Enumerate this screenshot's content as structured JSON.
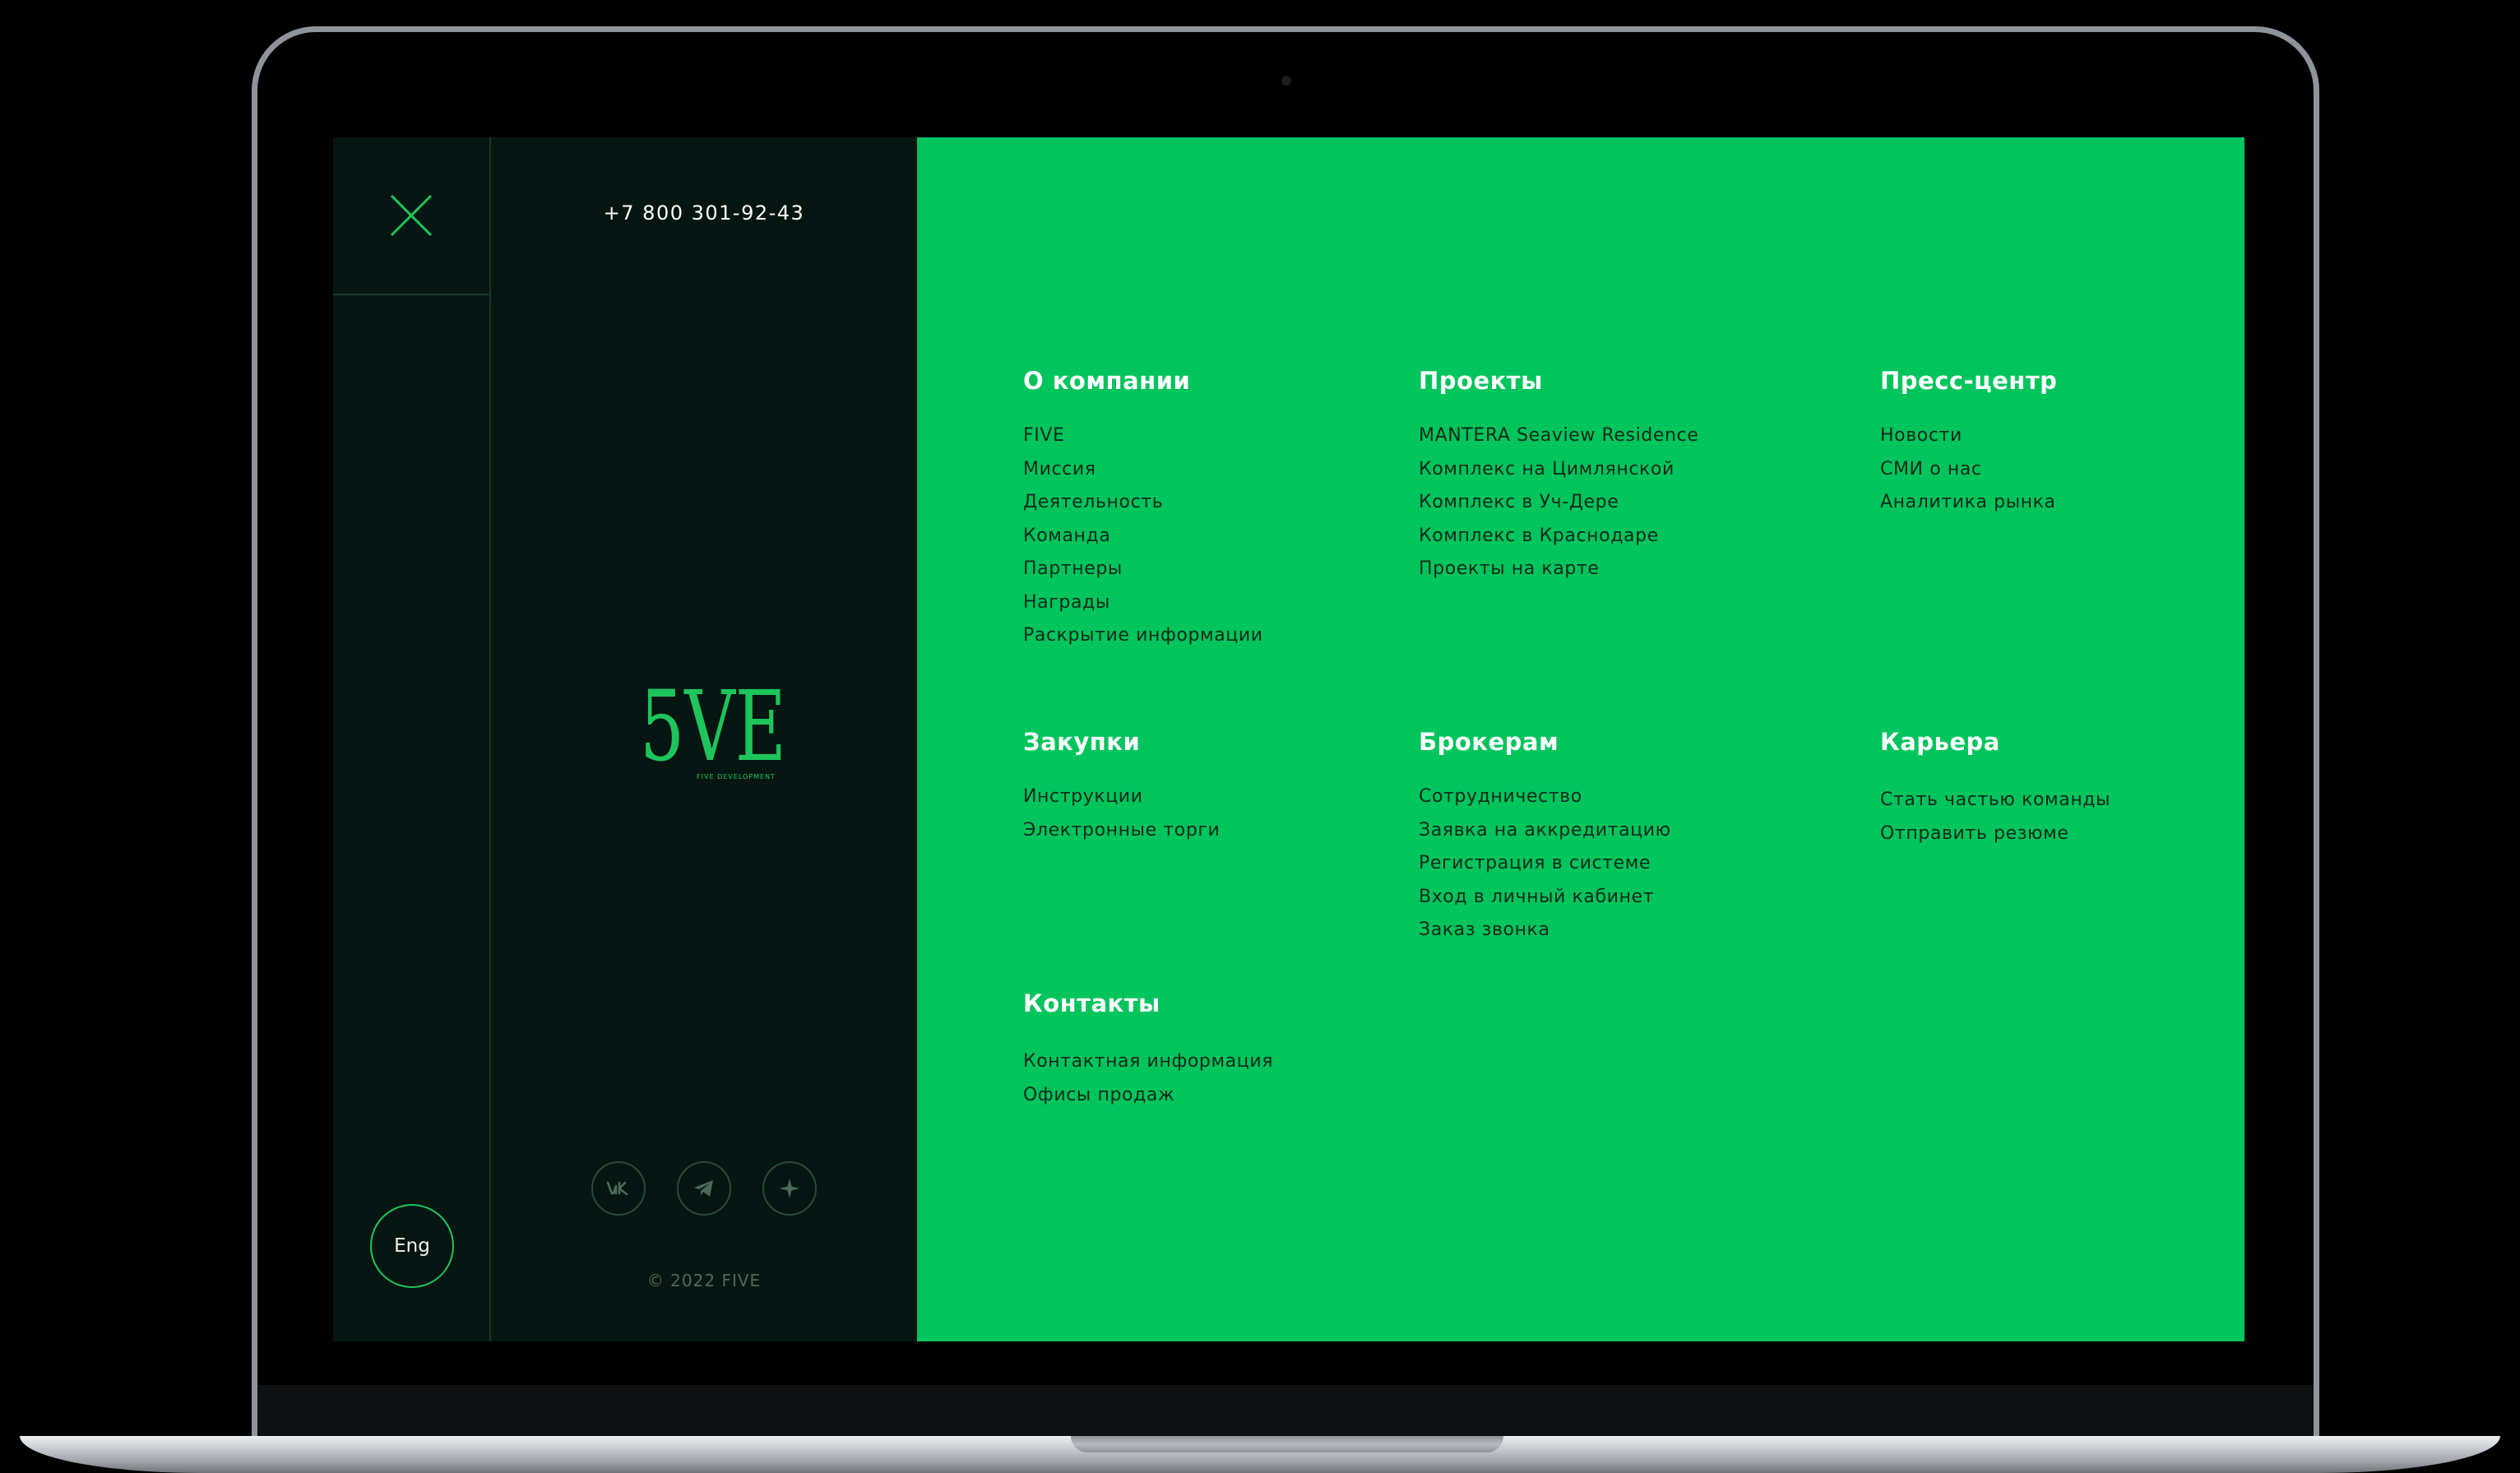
{
  "header": {
    "phone": "+7 800 301-92-43"
  },
  "language": {
    "label": "Eng"
  },
  "brand": {
    "logo_mark": "5VE",
    "logo_caption": "FIVE DEVELOPMENT"
  },
  "footer": {
    "copyright": "© 2022 FIVE",
    "socials": [
      "vk-icon",
      "telegram-icon",
      "sparkle-icon"
    ]
  },
  "icons": {
    "close": "close-icon"
  },
  "colors": {
    "accent": "#00C45C",
    "dark_bg": "#051612",
    "menu_text": "#0B2A1A"
  },
  "menu": {
    "company": {
      "title": "О компании",
      "items": [
        "FIVE",
        "Миссия",
        "Деятельность",
        "Команда",
        "Партнеры",
        "Награды",
        "Раскрытие информации"
      ]
    },
    "projects": {
      "title": "Проекты",
      "items": [
        "MANTERA Seaview Residence",
        "Комплекс на Цимлянской",
        "Комплекс в Уч-Дере",
        "Комплекс в Краснодаре",
        "Проекты на карте"
      ]
    },
    "press": {
      "title": "Пресс-центр",
      "items": [
        "Новости",
        "СМИ о нас",
        "Аналитика рынка"
      ]
    },
    "procurement": {
      "title": "Закупки",
      "items": [
        "Инструкции",
        "Электронные торги"
      ]
    },
    "brokers": {
      "title": "Брокерам",
      "items": [
        "Сотрудничество",
        "Заявка на аккредитацию",
        "Регистрация в системе",
        "Вход в личный кабинет",
        "Заказ звонка"
      ]
    },
    "career": {
      "title": "Карьера",
      "items": [
        "Стать частью команды",
        "Отправить резюме"
      ]
    },
    "contacts": {
      "title": "Контакты",
      "items": [
        "Контактная информация",
        "Офисы продаж"
      ]
    }
  }
}
